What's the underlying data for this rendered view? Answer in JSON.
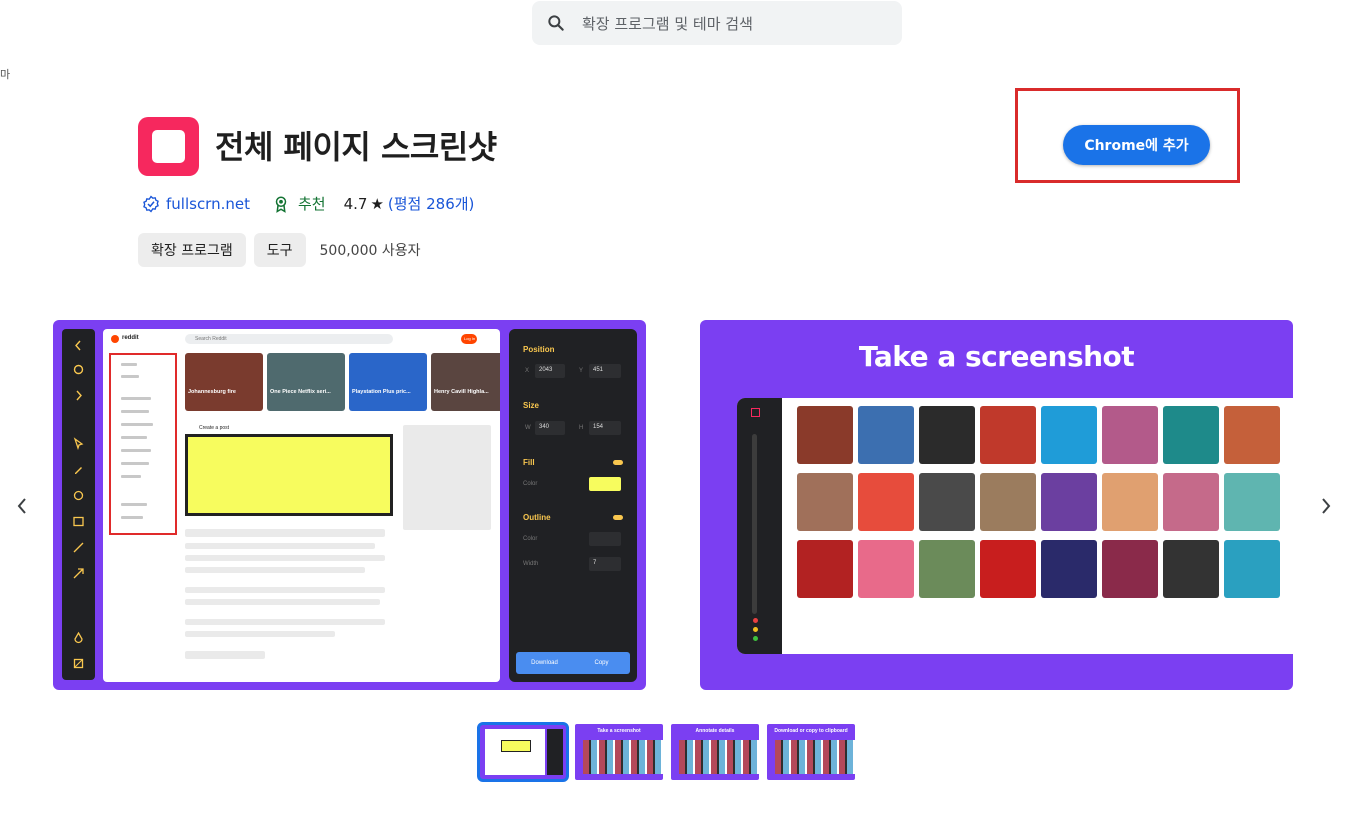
{
  "search": {
    "placeholder": "확장 프로그램 및 테마 검색"
  },
  "stray_text": "마",
  "extension": {
    "title": "전체 페이지 스크린샷",
    "site": "fullscrn.net",
    "featured": "추천",
    "rating": "4.7",
    "star": "★",
    "reviews": "(평점 286개)",
    "add_button": "Chrome에 추가",
    "brand_color": "#f6285e",
    "accent_color": "#1a73e8"
  },
  "chips": {
    "type": "확장 프로그램",
    "category": "도구",
    "users": "500,000 사용자"
  },
  "shot1_panel": {
    "position_label": "Position",
    "x_label": "X",
    "x_value": "2043",
    "y_label": "Y",
    "y_value": "451",
    "size_label": "Size",
    "w_label": "W",
    "w_value": "340",
    "h_label": "H",
    "h_value": "154",
    "fill_label": "Fill",
    "color_label": "Color",
    "outline_label": "Outline",
    "outline_color_label": "Color",
    "width_label": "Width",
    "width_value": "7",
    "download": "Download",
    "copy": "Copy"
  },
  "shot1_page": {
    "brand": "reddit",
    "search_placeholder": "Search Reddit",
    "login": "Log In",
    "cards": [
      "Johannesburg fire",
      "One Piece Netflix seri...",
      "Playstation Plus pric...",
      "Henry Cavill Highla..."
    ],
    "create_post": "Create a post"
  },
  "shot2": {
    "title": "Take a screenshot"
  },
  "thumbnails": [
    {
      "caption": ""
    },
    {
      "caption": "Take a screenshot"
    },
    {
      "caption": "Annotate details"
    },
    {
      "caption": "Download or copy to clipboard"
    }
  ]
}
